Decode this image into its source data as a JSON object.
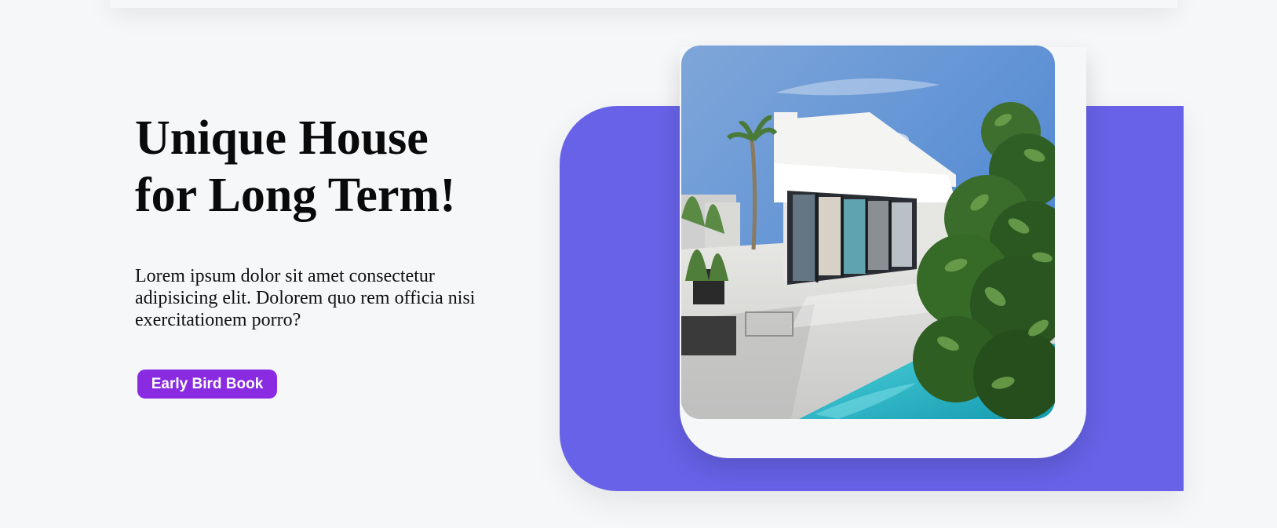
{
  "hero": {
    "title": "Unique House\nfor Long Term!",
    "description": "Lorem ipsum dolor sit amet consectetur adipisicing elit. Dolorem quo rem officia nisi exercitationem porro?",
    "cta_label": "Early Bird Book"
  },
  "image": {
    "subject": "house-photo"
  },
  "colors": {
    "background": "#f6f7f9",
    "panel": "#6762e8",
    "cta": "#8a2be2",
    "text": "#0a0a0a"
  }
}
